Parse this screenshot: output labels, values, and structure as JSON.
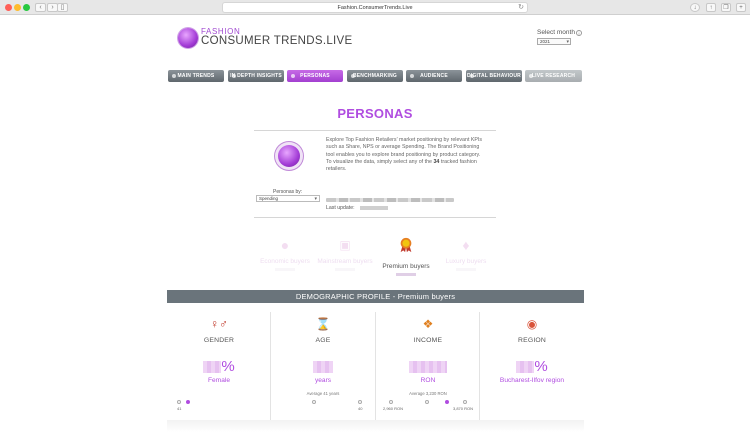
{
  "browser": {
    "url": "Fashion.ConsumerTrends.Live",
    "colors": {
      "close": "#ff5f57",
      "minimize": "#febc2e",
      "maximize": "#28c840"
    }
  },
  "header": {
    "logo_small": "FASHION",
    "logo_big": "CONSUMER TRENDS.LIVE",
    "select_month_label": "Select month",
    "month_value": "2021"
  },
  "nav": [
    {
      "label": "MAIN TRENDS"
    },
    {
      "label": "IN DEPTH INSIGHTS"
    },
    {
      "label": "PERSONAS"
    },
    {
      "label": "BENCHMARKING"
    },
    {
      "label": "AUDIENCE EXPLORER"
    },
    {
      "label": "DIGITAL BEHAVIOUR"
    },
    {
      "label": "LIVE RESEARCH"
    }
  ],
  "personas": {
    "title": "PERSONAS",
    "desc_1": "Explore Top Fashion Retailers' market positioning by relevant KPIs such as Share, NPS or average Spending. The Brand Positioning tool enables you to explore brand positioning by product category.",
    "desc_2_pre": "To visualize the data, simply select any of the ",
    "desc_count": "34",
    "desc_2_post": " tracked fashion retailers.",
    "personas_by_label": "Personas by:",
    "personas_by_value": "Spending",
    "last_update_label": "Last update:"
  },
  "buyers": [
    {
      "label": "Economic buyers",
      "icon": "piggy-bank"
    },
    {
      "label": "Mainstream buyers",
      "icon": "wallet"
    },
    {
      "label": "Premium buyers",
      "icon": "medal"
    },
    {
      "label": "Luxury buyers",
      "icon": "diamond"
    }
  ],
  "demographic": {
    "title": "DEMOGRAPHIC PROFILE - Premium buyers",
    "columns": [
      {
        "head": "GENDER",
        "icon": "gender-icon",
        "unit": "%",
        "sub": "Female",
        "avg": "",
        "scale_left": "41",
        "scale_right": ""
      },
      {
        "head": "AGE",
        "icon": "hourglass-icon",
        "unit": "",
        "sub": "years",
        "avg": "Average 41 years",
        "scale_left": "",
        "scale_right": "40"
      },
      {
        "head": "INCOME",
        "icon": "money-bag-icon",
        "unit": "",
        "sub": "RON",
        "avg": "Average 3,230 RON",
        "scale_left": "2,960 RON",
        "scale_right": "3,870 RON"
      },
      {
        "head": "REGION",
        "icon": "location-pin-icon",
        "unit": "%",
        "sub": "Bucharest-Ilfov region",
        "avg": "",
        "scale_left": "",
        "scale_right": ""
      }
    ]
  }
}
